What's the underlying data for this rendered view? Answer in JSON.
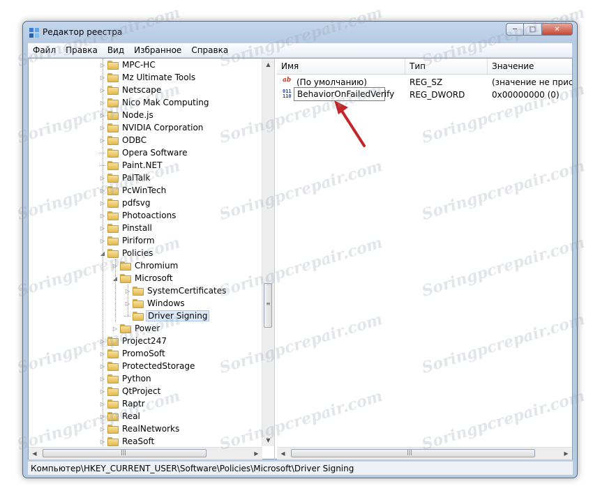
{
  "window": {
    "title": "Редактор реестра"
  },
  "menu": [
    "Файл",
    "Правка",
    "Вид",
    "Избранное",
    "Справка"
  ],
  "tree": [
    {
      "label": "MPC-HC",
      "depth": 0,
      "expander": "collapsed"
    },
    {
      "label": "Mz Ultimate Tools",
      "depth": 0,
      "expander": "collapsed"
    },
    {
      "label": "Netscape",
      "depth": 0,
      "expander": "collapsed"
    },
    {
      "label": "Nico Mak Computing",
      "depth": 0,
      "expander": "collapsed"
    },
    {
      "label": "Node.js",
      "depth": 0,
      "expander": "collapsed"
    },
    {
      "label": "NVIDIA Corporation",
      "depth": 0,
      "expander": "collapsed"
    },
    {
      "label": "ODBC",
      "depth": 0,
      "expander": "collapsed"
    },
    {
      "label": "Opera Software",
      "depth": 0,
      "expander": "none"
    },
    {
      "label": "Paint.NET",
      "depth": 0,
      "expander": "none"
    },
    {
      "label": "PalTalk",
      "depth": 0,
      "expander": "collapsed"
    },
    {
      "label": "PcWinTech",
      "depth": 0,
      "expander": "collapsed"
    },
    {
      "label": "pdfsvg",
      "depth": 0,
      "expander": "collapsed"
    },
    {
      "label": "Photoactions",
      "depth": 0,
      "expander": "collapsed"
    },
    {
      "label": "Pinstall",
      "depth": 0,
      "expander": "collapsed"
    },
    {
      "label": "Piriform",
      "depth": 0,
      "expander": "collapsed"
    },
    {
      "label": "Policies",
      "depth": 0,
      "expander": "expanded"
    },
    {
      "label": "Chromium",
      "depth": 1,
      "expander": "collapsed"
    },
    {
      "label": "Microsoft",
      "depth": 1,
      "expander": "expanded"
    },
    {
      "label": "SystemCertificates",
      "depth": 2,
      "expander": "collapsed"
    },
    {
      "label": "Windows",
      "depth": 2,
      "expander": "collapsed"
    },
    {
      "label": "Driver Signing",
      "depth": 2,
      "expander": "none",
      "selected": true
    },
    {
      "label": "Power",
      "depth": 1,
      "expander": "collapsed"
    },
    {
      "label": "Project247",
      "depth": 0,
      "expander": "collapsed"
    },
    {
      "label": "PromoSoft",
      "depth": 0,
      "expander": "collapsed"
    },
    {
      "label": "ProtectedStorage",
      "depth": 0,
      "expander": "collapsed"
    },
    {
      "label": "Python",
      "depth": 0,
      "expander": "collapsed"
    },
    {
      "label": "QtProject",
      "depth": 0,
      "expander": "collapsed"
    },
    {
      "label": "Raptr",
      "depth": 0,
      "expander": "collapsed"
    },
    {
      "label": "Real",
      "depth": 0,
      "expander": "collapsed"
    },
    {
      "label": "RealNetworks",
      "depth": 0,
      "expander": "collapsed"
    },
    {
      "label": "ReaSoft",
      "depth": 0,
      "expander": "collapsed"
    }
  ],
  "columns": {
    "name": "Имя",
    "type": "Тип",
    "value": "Значение"
  },
  "values": [
    {
      "icon": "string-value-icon",
      "name": "(По умолчанию)",
      "type": "REG_SZ",
      "data": "(значение не присвоено)"
    },
    {
      "icon": "dword-value-icon",
      "name": "BehaviorOnFailedVerify",
      "type": "REG_DWORD",
      "data": "0x00000000 (0)",
      "editing": true
    }
  ],
  "statusbar": "Компьютер\\HKEY_CURRENT_USER\\Software\\Policies\\Microsoft\\Driver Signing",
  "watermark": "Soringpcrepair.com",
  "colors": {
    "selection": "#dbe9f8",
    "arrow": "#c0262a",
    "titlebar": "#b7cbe3"
  }
}
